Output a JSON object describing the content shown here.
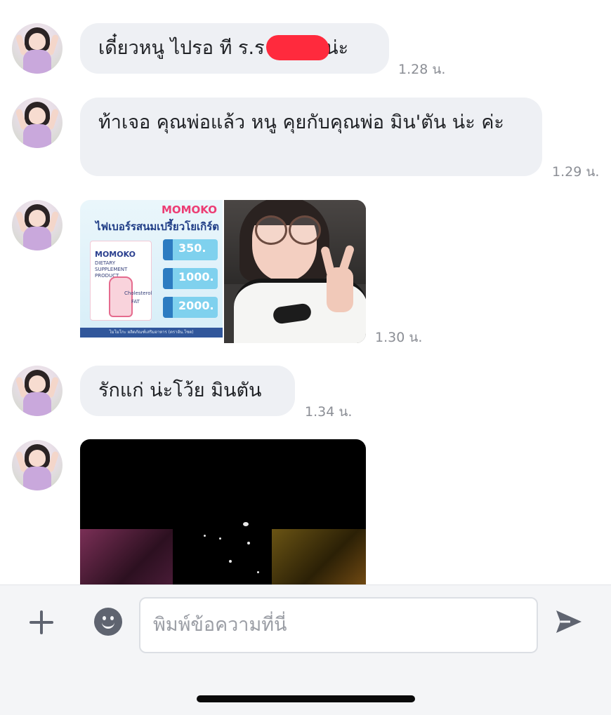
{
  "messages": [
    {
      "text_before": "เดี๋ยวหนู ไปรอ ที ร.ร",
      "text_after": "น่ะ",
      "time": "1.28 น."
    },
    {
      "text": "ท้าเจอ คุณพ่อแล้ว หนู คุยกับคุณพ่อ มิน'ตัน น่ะ ค่ะ",
      "time": "1.29 น."
    },
    {
      "time": "1.30 น.",
      "poster": {
        "brand": "MOMOKO",
        "title": "ไฟเบอร์รสนมเปรี้ยวโยเกิร์ต",
        "box_brand": "MOMOKO",
        "box_lines": [
          "DIETARY",
          "SUPPLEMENT",
          "PRODUCT",
          "Cholesterol",
          "FAT"
        ],
        "prices": [
          "350.",
          "1000.",
          "2000."
        ],
        "footer": "โมโมโกะ ผลิตภัณฑ์เสริมอาหาร (ตราอัน.โซต)"
      }
    },
    {
      "text": "รักแก่ น่ะโว้ย มินตัน",
      "time": "1.34 น."
    }
  ],
  "composer": {
    "placeholder": "พิมพ์ข้อความที่นี่"
  },
  "icons": {
    "add": "plus-icon",
    "emoji": "emoji-icon",
    "send": "send-icon"
  },
  "colors": {
    "bubble": "#eef0f4",
    "redaction": "#ff2a3d",
    "icon": "#5f6470"
  }
}
